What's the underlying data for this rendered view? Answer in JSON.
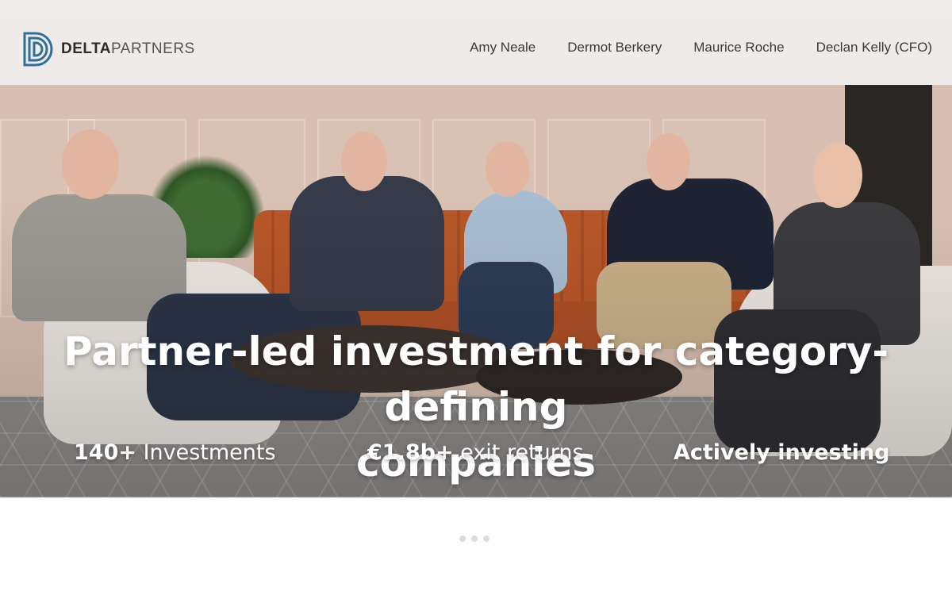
{
  "header": {
    "logo": {
      "icon": "delta-d-logo-icon",
      "bold_text": "DELTA",
      "light_text": "PARTNERS",
      "color": "#2f6f9a"
    },
    "nav": [
      {
        "label": "Amy Neale"
      },
      {
        "label": "Dermot Berkery"
      },
      {
        "label": "Maurice Roche"
      },
      {
        "label": "Declan Kelly (CFO)"
      }
    ]
  },
  "hero": {
    "image": "team-photo-five-partners-on-sofa",
    "headline_line1": "Partner-led investment for category-defining",
    "headline_line2": "companies",
    "stats": [
      {
        "value": "140+",
        "label": " Investments"
      },
      {
        "value": "€1.8b+",
        "label": " exit returns"
      },
      {
        "value": "Actively investing",
        "label": ""
      }
    ]
  },
  "slider": {
    "dots": 3,
    "dot_color": "#dcdcdc"
  }
}
